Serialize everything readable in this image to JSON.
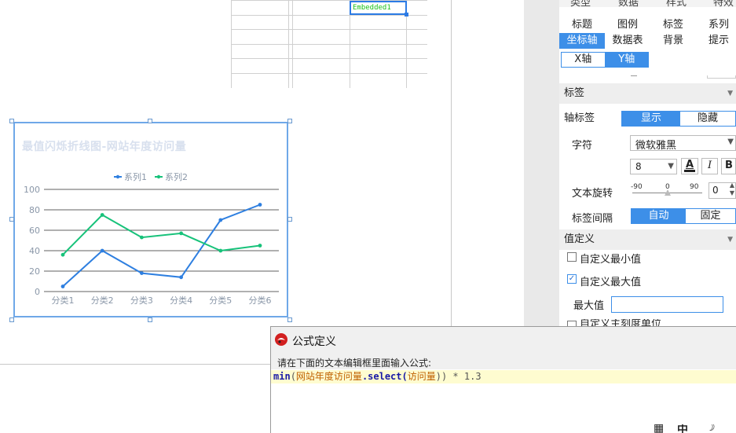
{
  "sheet": {
    "embedded_label": "Embedded1"
  },
  "chart_data": {
    "type": "line",
    "title": "最值闪烁折线图-网站年度访问量",
    "categories": [
      "分类1",
      "分类2",
      "分类3",
      "分类4",
      "分类5",
      "分类6"
    ],
    "series": [
      {
        "name": "系列1",
        "color": "#2e7fe0",
        "values": [
          5,
          40,
          18,
          14,
          70,
          85
        ]
      },
      {
        "name": "系列2",
        "color": "#17c27a",
        "values": [
          36,
          75,
          53,
          57,
          40,
          45
        ]
      }
    ],
    "yticks": [
      "100",
      "80",
      "60",
      "40",
      "20",
      "0"
    ],
    "ylim": [
      0,
      100
    ],
    "grid": true,
    "legend": "top-center"
  },
  "panel": {
    "top_tabs": [
      "类型",
      "数据",
      "样式",
      "特效"
    ],
    "style_tabs_row1": [
      "标题",
      "图例",
      "标签",
      "系列"
    ],
    "style_tabs_row2": [
      "坐标轴",
      "数据表",
      "背景",
      "提示"
    ],
    "axis_tabs": [
      "X轴",
      "Y轴"
    ],
    "section_label": "标签",
    "axis_label_title": "轴标签",
    "axis_label_show": "显示",
    "axis_label_hide": "隐藏",
    "font_label": "字符",
    "font_value": "微软雅黑",
    "font_size": "8",
    "bold_icon": "B",
    "italic_icon": "I",
    "rotate_label": "文本旋转",
    "rotate_ticks": [
      "-90",
      "0",
      "90"
    ],
    "rotate_value": "0",
    "interval_label": "标签间隔",
    "interval_auto": "自动",
    "interval_fixed": "固定",
    "value_section": "值定义",
    "custom_min": "自定义最小值",
    "custom_max": "自定义最大值",
    "max_value_label": "最大值",
    "custom_major": "自定义主刻度单位"
  },
  "dialog": {
    "title": "公式定义",
    "prompt": "请在下面的文本编辑框里面输入公式:",
    "formula_fn": "min",
    "formula_open": "(",
    "formula_arg1": "网站年度访问量",
    "formula_method": ".select(",
    "formula_arg2": "访问量",
    "formula_close": "))",
    "formula_rest": " * 1.3"
  }
}
